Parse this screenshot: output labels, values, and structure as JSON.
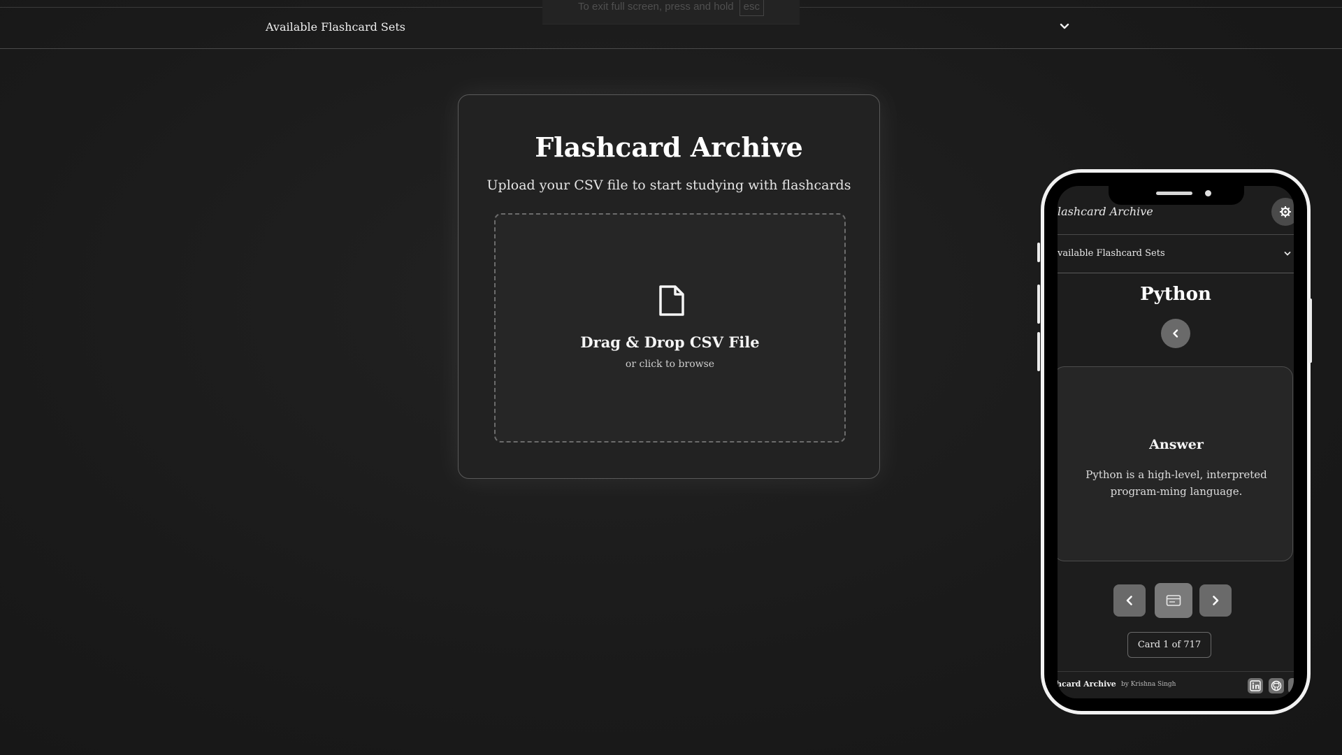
{
  "fullscreen_notice": {
    "message": "To exit full screen, press and hold",
    "key": "esc"
  },
  "set_selector": {
    "label": "Available Flashcard Sets"
  },
  "upload": {
    "title": "Flashcard Archive",
    "subtitle": "Upload your CSV file to start studying with flashcards",
    "dropzone_title": "Drag & Drop CSV File",
    "dropzone_subtitle": "or click to browse"
  },
  "mobile_preview": {
    "header_title": "lashcard Archive",
    "set_selector_label": "vailable Flashcard Sets",
    "deck_title": "Python",
    "card": {
      "heading": "Answer",
      "text": "Python is a high-level, interpreted program-ming language."
    },
    "counter": "Card 1 of 717",
    "footer": {
      "brand": "hcard Archive",
      "byline": "by Krishna Singh"
    }
  },
  "icons": {
    "file": "file-icon",
    "chevron": "chevron-down-icon",
    "gear": "gear-icon",
    "prev": "chevron-left-icon",
    "next": "chevron-right-icon",
    "flip": "card-flip-icon",
    "linkedin": "linkedin-icon",
    "github": "github-icon"
  },
  "colors": {
    "background": "#1c1c1c",
    "card": "#222222",
    "text": "#ffffff",
    "button": "#6a6a6a"
  }
}
